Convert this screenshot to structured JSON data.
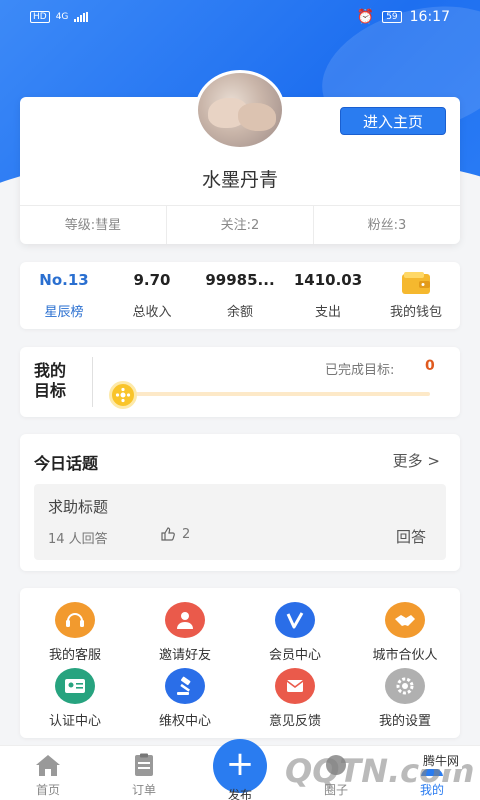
{
  "status_bar": {
    "network_type": "HD",
    "signal": "4G",
    "battery": "59",
    "time": "16:17"
  },
  "profile": {
    "enter_home_label": "进入主页",
    "nickname": "水墨丹青",
    "level": "等级:彗星",
    "following": "关注:2",
    "fans": "粉丝:3"
  },
  "wallet": {
    "rank_value": "No.13",
    "rank_label": "星辰榜",
    "income_value": "9.70",
    "income_label": "总收入",
    "balance_value": "99985...",
    "balance_label": "余额",
    "expense_value": "1410.03",
    "expense_label": "支出",
    "my_wallet_label": "我的钱包"
  },
  "goal": {
    "title": "我的目标",
    "completed_label": "已完成目标:",
    "completed_count": "0",
    "progress": 0
  },
  "topic": {
    "header": "今日话题",
    "more": "更多 >",
    "question": "求助标题",
    "answers": "14 人回答",
    "likes": "2",
    "reply_label": "回答"
  },
  "menu": {
    "items": [
      {
        "label": "我的客服",
        "icon": "headset-icon",
        "color": "#f29a2e"
      },
      {
        "label": "邀请好友",
        "icon": "invite-friend-icon",
        "color": "#ea5a4b"
      },
      {
        "label": "会员中心",
        "icon": "vip-icon",
        "color": "#2a6ee8"
      },
      {
        "label": "城市合伙人",
        "icon": "handshake-icon",
        "color": "#f29a2e"
      },
      {
        "label": "认证中心",
        "icon": "id-card-icon",
        "color": "#27a37f"
      },
      {
        "label": "维权中心",
        "icon": "gavel-icon",
        "color": "#2a6ee8"
      },
      {
        "label": "意见反馈",
        "icon": "mail-icon",
        "color": "#ea5a4b"
      },
      {
        "label": "我的设置",
        "icon": "gear-icon",
        "color": "#b0b0b0"
      }
    ]
  },
  "tabbar": {
    "home": "首页",
    "orders": "订单",
    "publish": "发布",
    "circle": "圈子",
    "mine": "我的"
  },
  "watermark": {
    "logo_text": "QQTN.com",
    "site": "腾牛网"
  },
  "colors": {
    "primary": "#2a7cf0",
    "accent_orange": "#e05a1e"
  }
}
